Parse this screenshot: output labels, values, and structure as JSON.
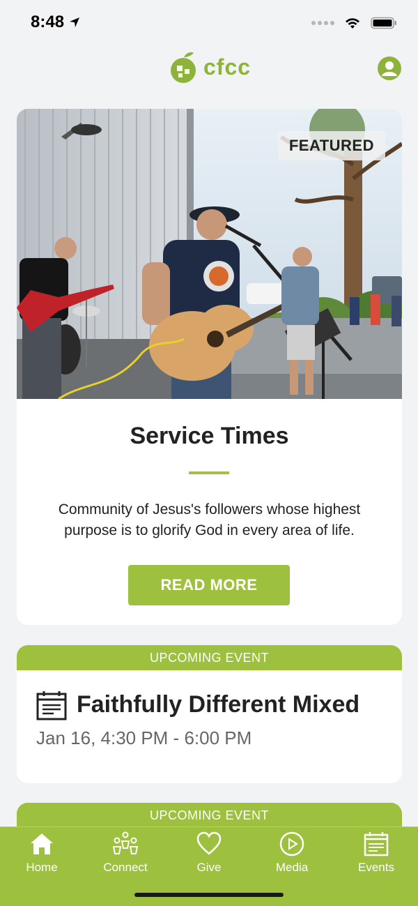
{
  "status_bar": {
    "time": "8:48"
  },
  "header": {
    "logo_text": "cfcc"
  },
  "featured": {
    "badge": "FEATURED",
    "title": "Service Times",
    "description": "Community of Jesus's followers whose highest purpose is to glorify God in every area of life.",
    "button_label": "READ MORE"
  },
  "events": [
    {
      "header": "UPCOMING EVENT",
      "title": "Faithfully Different Mixed",
      "date": "Jan 16, 4:30 PM - 6:00 PM"
    },
    {
      "header": "UPCOMING EVENT"
    }
  ],
  "tabs": [
    {
      "label": "Home",
      "icon": "home-icon"
    },
    {
      "label": "Connect",
      "icon": "people-icon"
    },
    {
      "label": "Give",
      "icon": "heart-icon"
    },
    {
      "label": "Media",
      "icon": "play-icon"
    },
    {
      "label": "Events",
      "icon": "calendar-icon"
    }
  ],
  "colors": {
    "accent": "#9dc13f",
    "background": "#f2f3f5",
    "text": "#222222"
  }
}
